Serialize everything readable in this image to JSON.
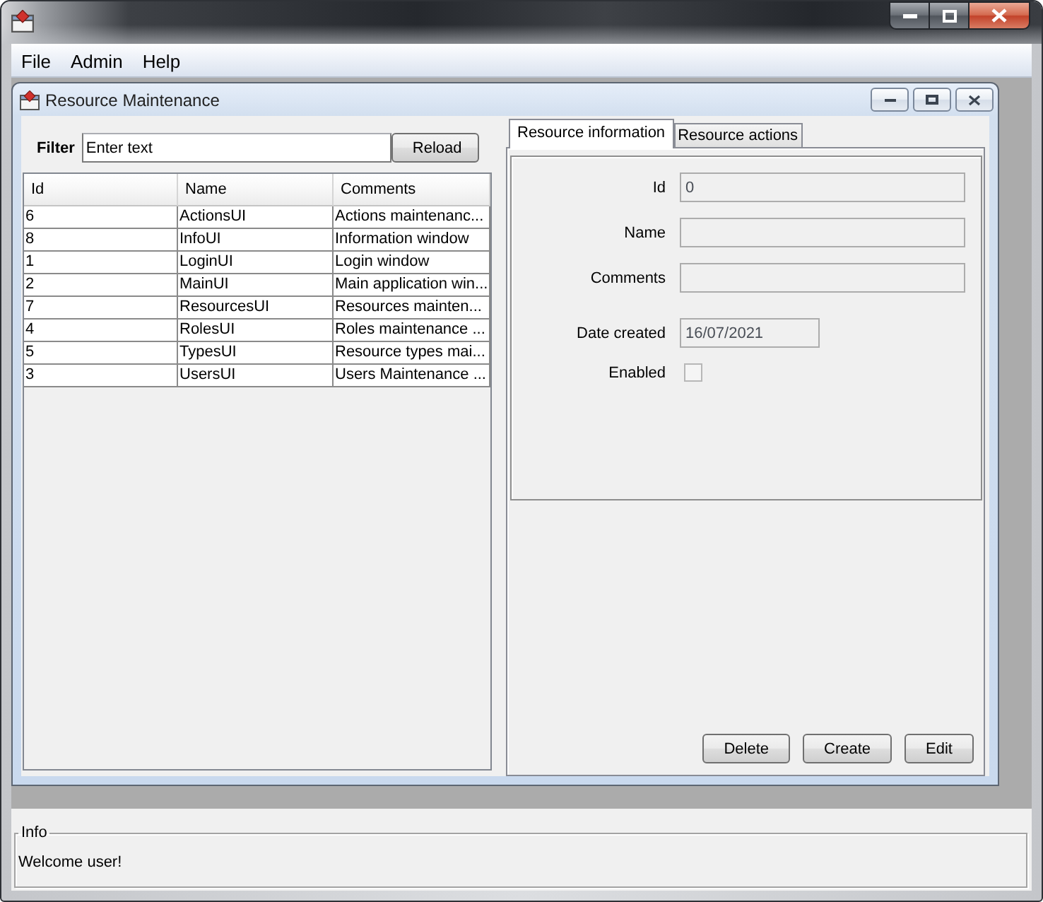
{
  "menu_bar": {
    "items": [
      "File",
      "Admin",
      "Help"
    ]
  },
  "internal_frame": {
    "title": "Resource Maintenance"
  },
  "filter": {
    "label": "Filter",
    "placeholder": "Enter text",
    "button": "Reload"
  },
  "table": {
    "columns": [
      "Id",
      "Name",
      "Comments"
    ],
    "rows": [
      [
        "6",
        "ActionsUI",
        "Actions maintenanc..."
      ],
      [
        "8",
        "InfoUI",
        "Information window"
      ],
      [
        "1",
        "LoginUI",
        "Login window"
      ],
      [
        "2",
        "MainUI",
        "Main application win..."
      ],
      [
        "7",
        "ResourcesUI",
        "Resources mainten..."
      ],
      [
        "4",
        "RolesUI",
        "Roles maintenance ..."
      ],
      [
        "5",
        "TypesUI",
        "Resource types mai..."
      ],
      [
        "3",
        "UsersUI",
        "Users Maintenance ..."
      ]
    ]
  },
  "tabs": [
    {
      "label": "Resource information",
      "selected": true
    },
    {
      "label": "Resource actions",
      "selected": false
    }
  ],
  "form": {
    "fields": [
      {
        "kind": "text",
        "label": "Id",
        "value": "0",
        "disabled": true
      },
      {
        "kind": "text",
        "label": "Name",
        "disabled": true
      },
      {
        "kind": "text",
        "label": "Comments",
        "disabled": true
      },
      {
        "kind": "date",
        "label": "Date created",
        "value": "16/07/2021",
        "disabled": true
      },
      {
        "kind": "checkbox",
        "label": "Enabled",
        "checked": false,
        "disabled": true
      }
    ]
  },
  "actions": [
    "Delete",
    "Create",
    "Edit"
  ],
  "info": {
    "title": "Info",
    "message": "Welcome user!"
  }
}
